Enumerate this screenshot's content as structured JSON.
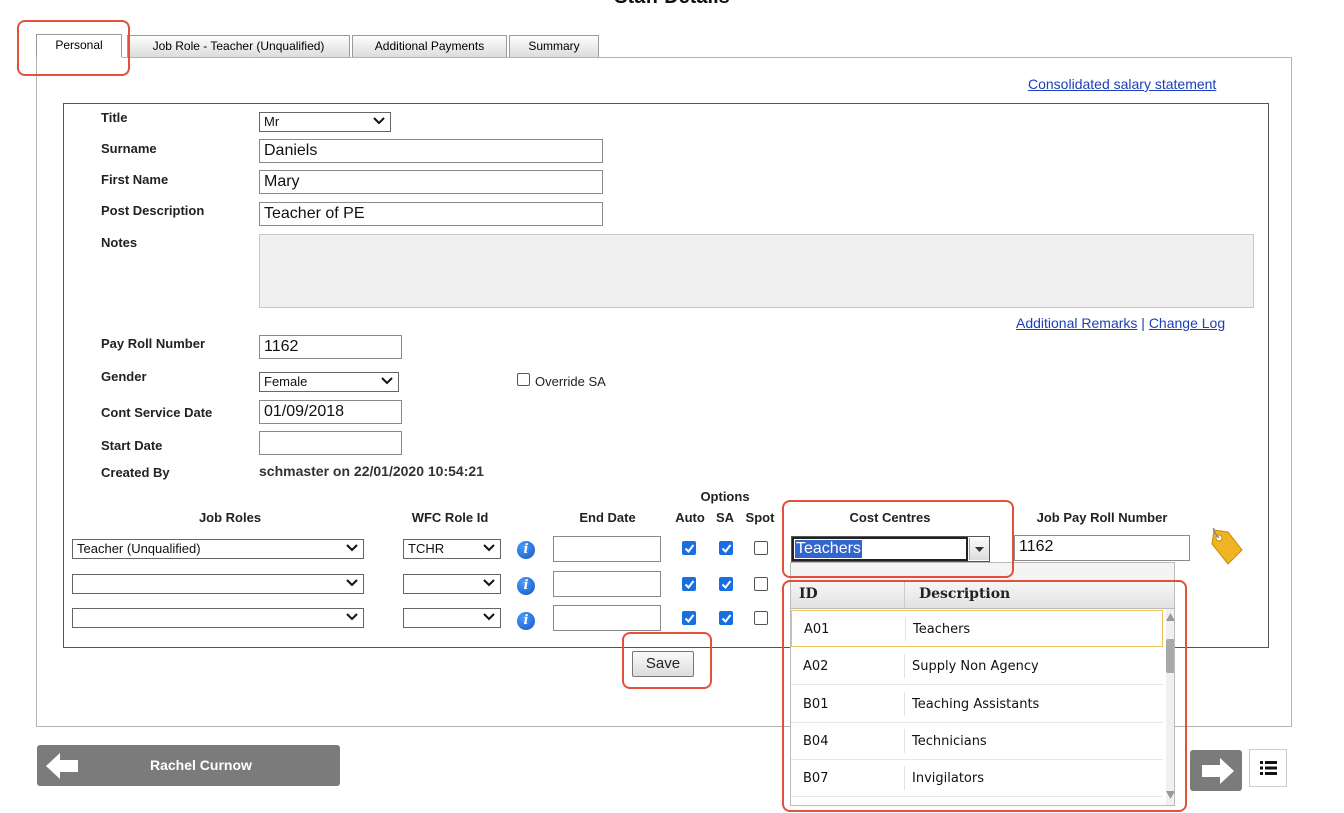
{
  "page_title": "Staff Details",
  "tabs": [
    {
      "label": "Personal"
    },
    {
      "label": "Job Role - Teacher (Unqualified)"
    },
    {
      "label": "Additional Payments"
    },
    {
      "label": "Summary"
    }
  ],
  "links": {
    "consolidated": "Consolidated salary statement",
    "additional_remarks": "Additional Remarks",
    "separator": "|",
    "change_log": "Change Log"
  },
  "form": {
    "title_label": "Title",
    "title_value": "Mr",
    "surname_label": "Surname",
    "surname_value": "Daniels",
    "first_name_label": "First Name",
    "first_name_value": "Mary",
    "post_desc_label": "Post Description",
    "post_desc_value": "Teacher of PE",
    "notes_label": "Notes",
    "payroll_label": "Pay Roll Number",
    "payroll_value": "1162",
    "gender_label": "Gender",
    "gender_value": "Female",
    "override_label": "Override SA",
    "cont_service_label": "Cont Service Date",
    "cont_service_value": "01/09/2018",
    "start_date_label": "Start Date",
    "start_date_value": "",
    "created_by_label": "Created By",
    "created_by_value": "schmaster on 22/01/2020 10:54:21"
  },
  "roles_table": {
    "options_header": "Options",
    "headers": {
      "job_roles": "Job Roles",
      "wfc": "WFC Role Id",
      "end_date": "End Date",
      "auto": "Auto",
      "sa": "SA",
      "spot": "Spot",
      "cost_centres": "Cost Centres",
      "job_payroll": "Job Pay Roll Number"
    },
    "rows": [
      {
        "job_role": "Teacher (Unqualified)",
        "wfc": "TCHR",
        "end_date": "",
        "auto": true,
        "sa": true,
        "spot": false,
        "cost_centre": "Teachers",
        "job_payroll": "1162"
      },
      {
        "job_role": "",
        "wfc": "",
        "end_date": "",
        "auto": true,
        "sa": true,
        "spot": false
      },
      {
        "job_role": "",
        "wfc": "",
        "end_date": "",
        "auto": true,
        "sa": true,
        "spot": false
      }
    ]
  },
  "cost_centre_dropdown": {
    "headers": {
      "id": "ID",
      "description": "Description"
    },
    "items": [
      {
        "id": "A01",
        "description": "Teachers"
      },
      {
        "id": "A02",
        "description": "Supply Non Agency"
      },
      {
        "id": "B01",
        "description": "Teaching Assistants"
      },
      {
        "id": "B04",
        "description": "Technicians"
      },
      {
        "id": "B07",
        "description": "Invigilators"
      }
    ]
  },
  "save_label": "Save",
  "nav": {
    "prev_label": "Rachel Curnow"
  },
  "colors": {
    "highlight": "#e1513b",
    "checkbox": "#1a6fe0",
    "link": "#1a3fb8",
    "nav_button": "#7b7b7b"
  }
}
